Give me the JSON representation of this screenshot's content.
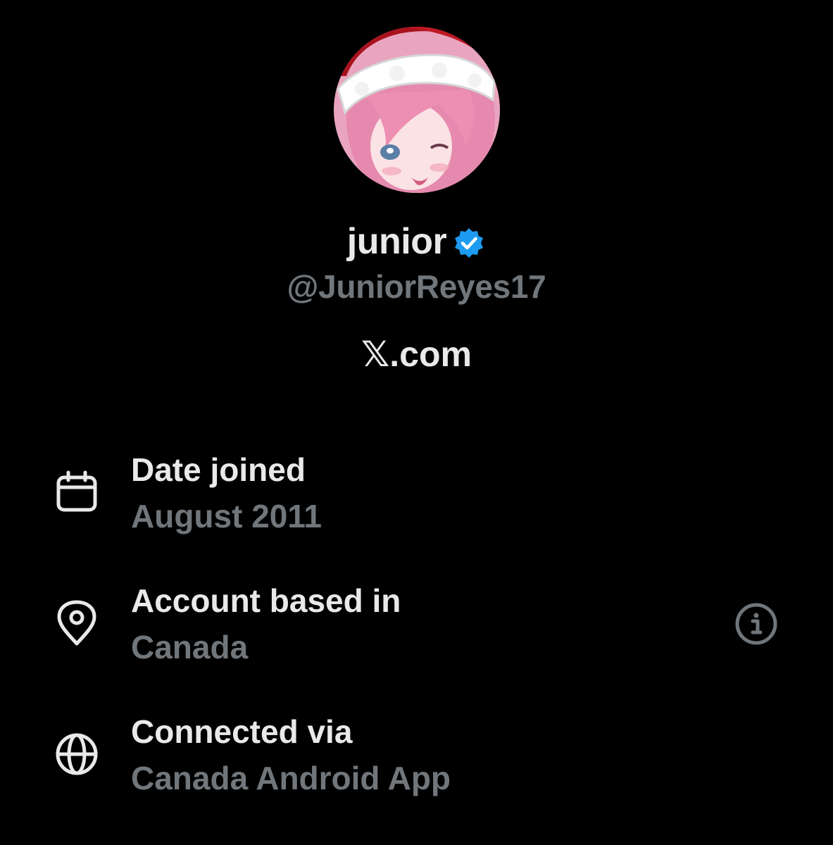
{
  "profile": {
    "avatar_icon": "avatar-santa-hat-anime-girl",
    "display_name": "junior",
    "verified_icon": "verified-badge-icon",
    "handle": "@JuniorReyes17",
    "website": "𝕏.com"
  },
  "about": {
    "items": [
      {
        "icon": "calendar-icon",
        "label": "Date joined",
        "value": "August 2011"
      },
      {
        "icon": "location-pin-icon",
        "label": "Account based in",
        "value": "Canada",
        "has_info_button": true
      },
      {
        "icon": "globe-icon",
        "label": "Connected via",
        "value": "Canada Android App"
      }
    ]
  },
  "colors": {
    "background": "#000000",
    "primary_text": "#e7e9ea",
    "secondary_text": "#71767b",
    "verified_blue": "#1d9bf0"
  }
}
